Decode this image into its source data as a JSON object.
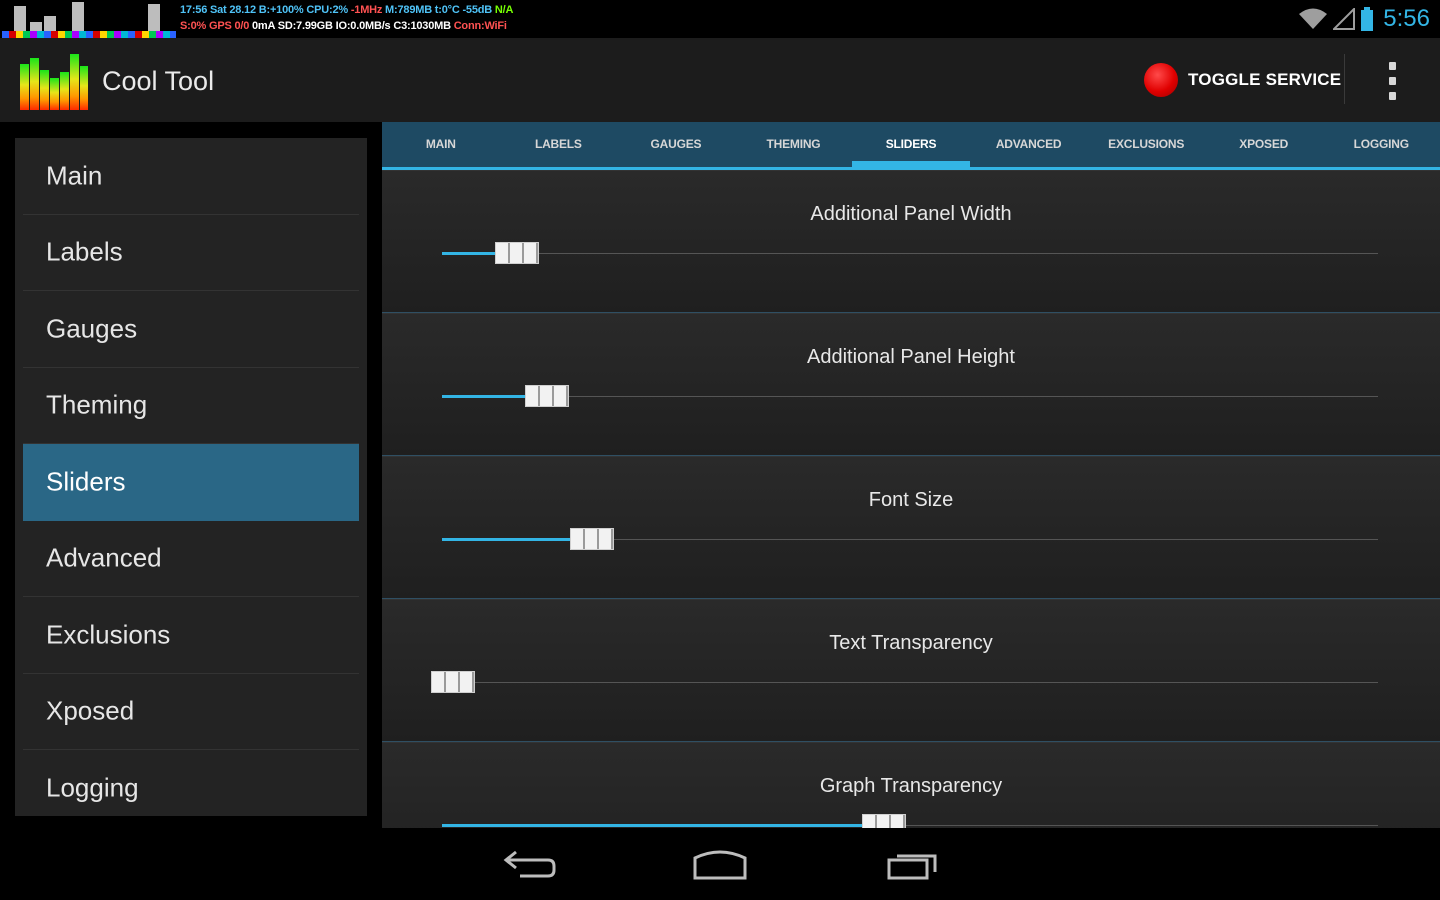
{
  "status_bar": {
    "line1": "17:56 Sat 28.12 B:+100% CPU:2% ",
    "line1_freq": "-1MHz",
    "line1_mem": " M:789MB t:0°C -55dB ",
    "line1_na": "N/A",
    "line2": "S:0% ",
    "line2_gps": "GPS 0/0",
    "line2_rest": " 0mA SD:7.99GB ",
    "line2_io": "IO:0.0MB/s C3:1030MB ",
    "line2_conn": "Conn:WiFi",
    "time": "5:56"
  },
  "action_bar": {
    "title": "Cool Tool",
    "toggle_service": "TOGGLE SERVICE"
  },
  "sidebar": {
    "items": [
      {
        "label": "Main"
      },
      {
        "label": "Labels"
      },
      {
        "label": "Gauges"
      },
      {
        "label": "Theming"
      },
      {
        "label": "Sliders"
      },
      {
        "label": "Advanced"
      },
      {
        "label": "Exclusions"
      },
      {
        "label": "Xposed"
      },
      {
        "label": "Logging"
      }
    ],
    "active_index": 4
  },
  "tabs": {
    "items": [
      "MAIN",
      "LABELS",
      "GAUGES",
      "THEMING",
      "SLIDERS",
      "ADVANCED",
      "EXCLUSIONS",
      "XPOSED",
      "LOGGING"
    ],
    "active_index": 4
  },
  "sliders": [
    {
      "title": "Additional Panel Width",
      "value_fraction": 0.08
    },
    {
      "title": "Additional Panel Height",
      "value_fraction": 0.112
    },
    {
      "title": "Font Size",
      "value_fraction": 0.16
    },
    {
      "title": "Text Transparency",
      "value_fraction": 0.012
    },
    {
      "title": "Graph Transparency",
      "value_fraction": 0.472
    }
  ],
  "colors": {
    "accent": "#33b5e5",
    "selected_nav": "#2a6786",
    "tab_bar": "#1e4a63",
    "toggle_dot": "#e00000"
  },
  "icons": [
    "app-logo-icon",
    "wifi-icon",
    "signal-icon",
    "battery-icon",
    "red-dot-icon",
    "overflow-menu-icon",
    "back-icon",
    "home-icon",
    "recents-icon"
  ]
}
